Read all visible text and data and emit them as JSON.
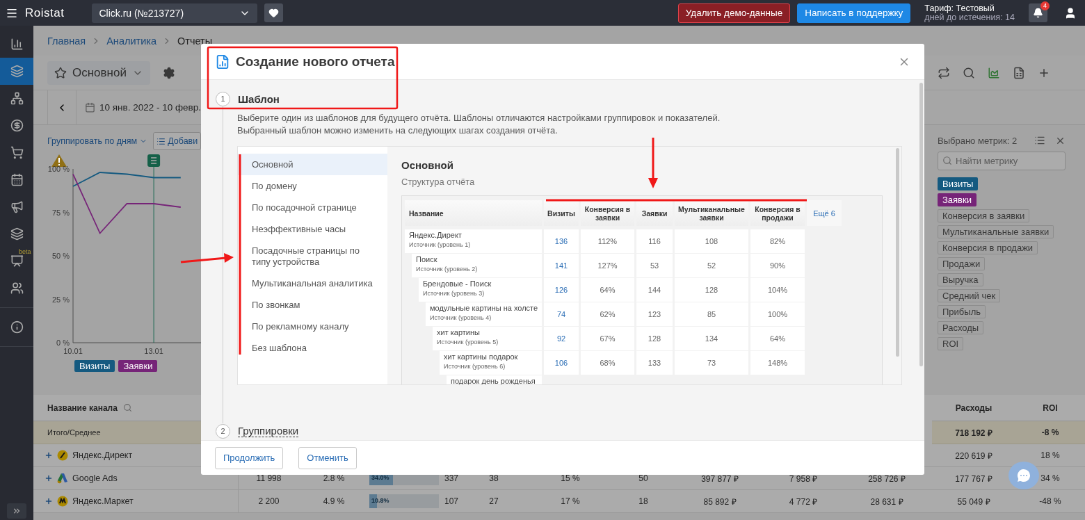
{
  "topbar": {
    "brand": "Roistat",
    "project": "Click.ru (№213727)",
    "actions": [
      {
        "label": "Удалить демо-данные",
        "kind": "danger"
      },
      {
        "label": "Написать в поддержку",
        "kind": "primary"
      }
    ],
    "tariff": "Тариф: Тестовый",
    "expiry": "дней до истечения: 14",
    "notifications": "4"
  },
  "sidebar": {
    "items": [
      {
        "selected": false
      },
      {
        "selected": true
      },
      {
        "selected": false
      },
      {
        "selected": false
      },
      {
        "selected": false
      },
      {
        "selected": false
      },
      {
        "selected": false
      },
      {
        "selected": false
      },
      {
        "selected": false,
        "badge": "beta"
      },
      {
        "selected": false
      },
      {
        "selected": false
      }
    ]
  },
  "breadcrumbs": [
    {
      "label": "Главная",
      "link": true
    },
    {
      "label": "Аналитика",
      "link": true
    },
    {
      "label": "Отчеты",
      "link": false
    }
  ],
  "report": {
    "name": "Основной",
    "date_range": "10 янв. 2022 - 10 февр.",
    "group_by": "Группировать по дням",
    "add_button": "Добави"
  },
  "chart": {
    "chart_data": {
      "type": "line",
      "categories": [
        "10.01",
        null,
        null,
        "13.01",
        null,
        null
      ],
      "ylim": [
        0,
        100
      ],
      "yticks": [
        {
          "value": 0,
          "label": "0 %"
        },
        {
          "value": 25,
          "label": "25 %"
        },
        {
          "value": 50,
          "label": "50 %"
        },
        {
          "value": 75,
          "label": "75 %"
        },
        {
          "value": 100,
          "label": "100 %"
        }
      ],
      "series": [
        {
          "name": "Визиты",
          "color": "#155a80",
          "values": [
            90,
            98,
            97,
            95,
            95,
            null
          ]
        },
        {
          "name": "Заявки",
          "color": "#762478",
          "values": [
            97,
            63,
            80,
            80,
            78,
            null
          ]
        }
      ]
    }
  },
  "metrics_panel": {
    "title": "Выбрано метрик: 2",
    "search_placeholder": "Найти метрику",
    "metrics": [
      {
        "label": "Визиты",
        "selected": true,
        "color": "#155a80"
      },
      {
        "label": "Заявки",
        "selected": true,
        "color": "#762478"
      },
      {
        "label": "Конверсия в заявки",
        "selected": false
      },
      {
        "label": "Мультиканальные заявки",
        "selected": false
      },
      {
        "label": "Конверсия в продажи",
        "selected": false
      },
      {
        "label": "Продажи",
        "selected": false
      },
      {
        "label": "Выручка",
        "selected": false
      },
      {
        "label": "Средний чек",
        "selected": false
      },
      {
        "label": "Прибыль",
        "selected": false
      },
      {
        "label": "Расходы",
        "selected": false
      },
      {
        "label": "ROI",
        "selected": false
      }
    ]
  },
  "channel_table": {
    "name_header": "Название канала",
    "headers": [
      "Расходы",
      "ROI"
    ],
    "total": {
      "label": "Итого/Среднее",
      "values": [
        "718 192 ₽",
        "-8 %"
      ]
    },
    "rows": [
      {
        "name": "Яндекс.Директ",
        "cells": [
          {
            "kind": "covered"
          },
          {
            "kind": "covered"
          },
          {
            "kind": "covered"
          },
          {
            "kind": "covered"
          },
          {
            "kind": "covered"
          },
          {
            "kind": "covered"
          },
          {
            "kind": "covered"
          },
          {
            "kind": "covered"
          },
          {
            "kind": "covered"
          },
          {
            "kind": "text",
            "text": "220 619 ₽"
          },
          {
            "kind": "text",
            "text": "18 %"
          }
        ]
      },
      {
        "name": "Google Ads",
        "cells": [
          {
            "kind": "text",
            "text": "11 998"
          },
          {
            "kind": "text",
            "text": "2.8 %"
          },
          {
            "kind": "bar",
            "label": "34.0%",
            "level": 0.34,
            "text": "337"
          },
          {
            "kind": "text",
            "text": "38"
          },
          {
            "kind": "text",
            "text": "15 %"
          },
          {
            "kind": "text",
            "text": "50"
          },
          {
            "kind": "text",
            "text": "397 877 ₽"
          },
          {
            "kind": "text",
            "text": "7 958 ₽"
          },
          {
            "kind": "text",
            "text": "258 726 ₽"
          },
          {
            "kind": "text",
            "text": "177 767 ₽"
          },
          {
            "kind": "text",
            "text": "34 %"
          }
        ]
      },
      {
        "name": "Яндекс.Маркет",
        "cells": [
          {
            "kind": "text",
            "text": "2 200"
          },
          {
            "kind": "text",
            "text": "4.9 %"
          },
          {
            "kind": "bar",
            "label": "10.8%",
            "level": 0.108,
            "text": "107"
          },
          {
            "kind": "text",
            "text": "27"
          },
          {
            "kind": "text",
            "text": "17 %"
          },
          {
            "kind": "text",
            "text": "18"
          },
          {
            "kind": "text",
            "text": "85 892 ₽"
          },
          {
            "kind": "text",
            "text": "4 772 ₽"
          },
          {
            "kind": "text",
            "text": "28 631 ₽"
          },
          {
            "kind": "text",
            "text": "55 049 ₽"
          },
          {
            "kind": "text",
            "text": "-48 %"
          }
        ]
      }
    ]
  },
  "modal": {
    "title": "Создание нового отчета",
    "steps": [
      {
        "number": "1",
        "title": "Шаблон",
        "description": [
          "Выберите один из шаблонов для будущего отчёта. Шаблоны отличаются настройками группировок и показателей.",
          "Выбранный шаблон можно изменить на следующих шагах создания отчёта."
        ]
      },
      {
        "number": "2",
        "title": "Группировки"
      }
    ],
    "templates": [
      {
        "label": "Основной",
        "selected": true
      },
      {
        "label": "По домену",
        "selected": false
      },
      {
        "label": "По посадочной странице",
        "selected": false
      },
      {
        "label": "Неэффективные часы",
        "selected": false
      },
      {
        "label": "Посадочные страницы по типу устройства",
        "selected": false
      },
      {
        "label": "Мультиканальная аналитика",
        "selected": false
      },
      {
        "label": "По звонкам",
        "selected": false
      },
      {
        "label": "По рекламному каналу",
        "selected": false
      },
      {
        "label": "Без шаблона",
        "selected": false
      }
    ],
    "preview": {
      "title": "Основной",
      "subtitle": "Структура отчёта",
      "columns": [
        "Название",
        "Визиты",
        "Конверсия в заявки",
        "Заявки",
        "Мультиканальные заявки",
        "Конверсия в продажи"
      ],
      "more": "Ещё 6",
      "rows": [
        {
          "name": "Яндекс.Директ",
          "source": "Источник (уровень 1)",
          "values": [
            "136",
            "112%",
            "116",
            "108",
            "82%"
          ],
          "children": [
            {
              "name": "Поиск",
              "source": "Источник (уровень 2)",
              "values": [
                "141",
                "127%",
                "53",
                "52",
                "90%"
              ],
              "children": [
                {
                  "name": "Брендовые - Поиск",
                  "source": "Источник (уровень 3)",
                  "values": [
                    "126",
                    "64%",
                    "144",
                    "128",
                    "104%"
                  ],
                  "children": [
                    {
                      "name": "модульные картины на холсте",
                      "source": "Источник (уровень 4)",
                      "values": [
                        "74",
                        "62%",
                        "123",
                        "85",
                        "100%"
                      ],
                      "children": [
                        {
                          "name": "хит картины",
                          "source": "Источник (уровень 5)",
                          "values": [
                            "92",
                            "67%",
                            "128",
                            "134",
                            "64%"
                          ],
                          "children": [
                            {
                              "name": "хит картины подарок",
                              "source": "Источник (уровень 6)",
                              "values": [
                                "106",
                                "68%",
                                "133",
                                "73",
                                "148%"
                              ],
                              "children": [
                                {
                                  "name": "подарок день рожденья"
                                }
                              ]
                            }
                          ]
                        }
                      ]
                    }
                  ]
                }
              ]
            }
          ]
        }
      ]
    },
    "buttons": [
      {
        "label": "Продолжить"
      },
      {
        "label": "Отменить"
      }
    ]
  }
}
